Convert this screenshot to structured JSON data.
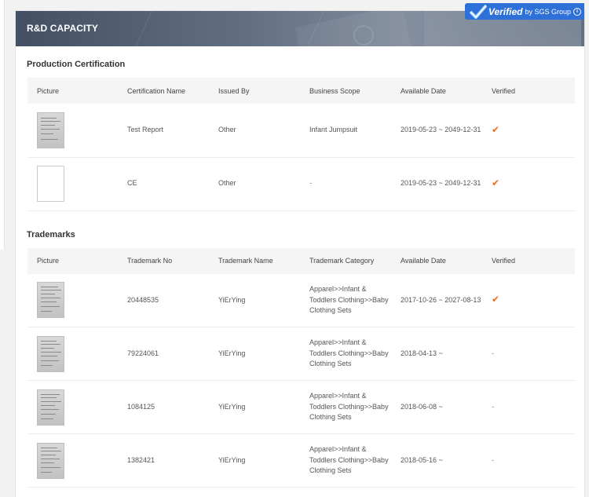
{
  "header": {
    "title": "R&D CAPACITY",
    "badge": {
      "verified": "Verified",
      "by": "by SGS Group",
      "info": "i"
    }
  },
  "certifications": {
    "title": "Production Certification",
    "columns": [
      "Picture",
      "Certification Name",
      "Issued By",
      "Business Scope",
      "Available Date",
      "Verified"
    ],
    "rows": [
      {
        "picture": "document-scan",
        "name": "Test Report",
        "issued_by": "Other",
        "scope": "Infant Jumpsuit",
        "date": "2019-05-23 ~ 2049-12-31",
        "verified": "✔"
      },
      {
        "picture": "blank",
        "name": "CE",
        "issued_by": "Other",
        "scope": "-",
        "date": "2019-05-23 ~ 2049-12-31",
        "verified": "✔"
      }
    ]
  },
  "trademarks": {
    "title": "Trademarks",
    "columns": [
      "Picture",
      "Trademark No",
      "Trademark Name",
      "Trademark Category",
      "Available Date",
      "Verified"
    ],
    "rows": [
      {
        "picture": "document-scan",
        "number": "20448535",
        "name": "YiErYing",
        "category": "Apparel>>Infant & Toddlers Clothing>>Baby Clothing Sets",
        "date": "2017-10-26 ~ 2027-08-13",
        "verified": "✔"
      },
      {
        "picture": "document-scan",
        "number": "79224061",
        "name": "YiErYing",
        "category": "Apparel>>Infant & Toddlers Clothing>>Baby Clothing Sets",
        "date": "2018-04-13 ~",
        "verified": "-"
      },
      {
        "picture": "document-scan",
        "number": "1084125",
        "name": "YiErYing",
        "category": "Apparel>>Infant & Toddlers Clothing>>Baby Clothing Sets",
        "date": "2018-06-08 ~",
        "verified": "-"
      },
      {
        "picture": "document-scan",
        "number": "1382421",
        "name": "YiErYing",
        "category": "Apparel>>Infant & Toddlers Clothing>>Baby Clothing Sets",
        "date": "2018-05-16 ~",
        "verified": "-"
      }
    ]
  },
  "colors": {
    "accent_check": "#e86d1f",
    "badge_blue": "#2d70d8",
    "header_bg": "#4c5a70"
  }
}
